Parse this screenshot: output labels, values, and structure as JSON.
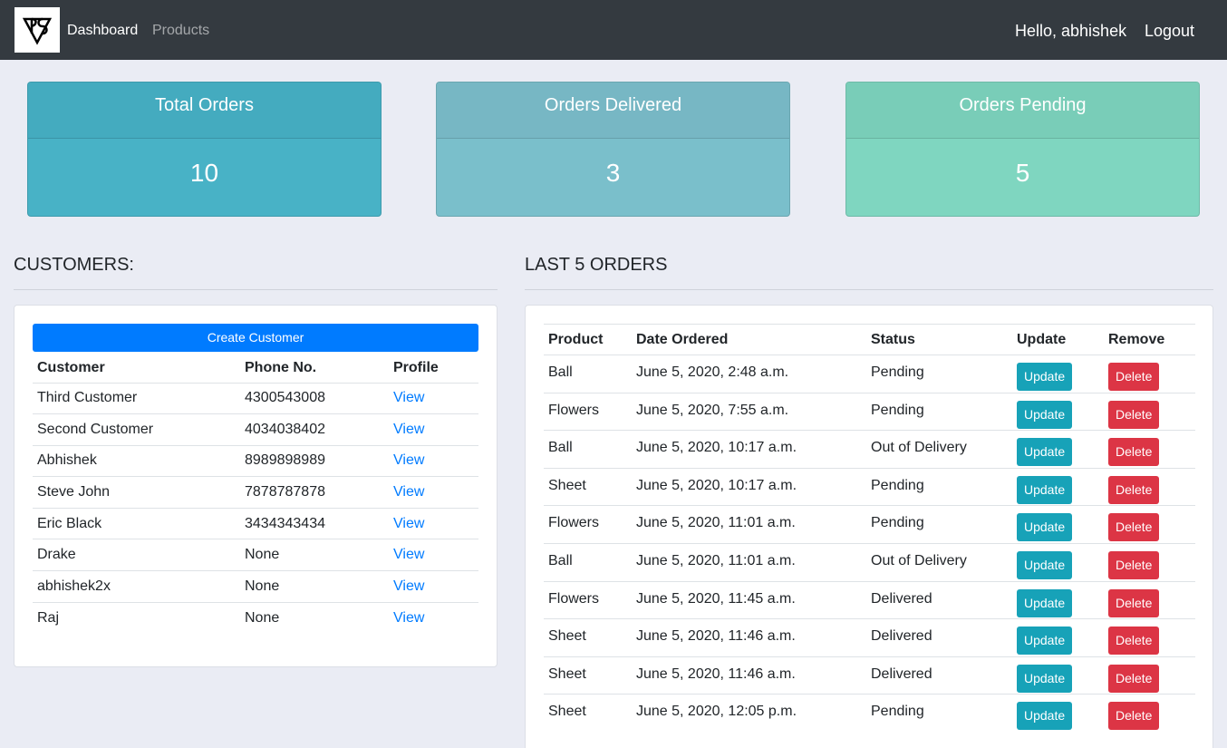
{
  "nav": {
    "dashboard": "Dashboard",
    "products": "Products",
    "greeting": "Hello, abhishek",
    "logout": "Logout"
  },
  "stats": {
    "total": {
      "label": "Total Orders",
      "value": "10"
    },
    "delivered": {
      "label": "Orders Delivered",
      "value": "3"
    },
    "pending": {
      "label": "Orders Pending",
      "value": "5"
    }
  },
  "customers": {
    "title": "CUSTOMERS:",
    "create_label": "Create Customer",
    "headers": [
      "Customer",
      "Phone No.",
      "Profile"
    ],
    "rows": [
      {
        "name": "Third Customer",
        "phone": "4300543008",
        "link": "View"
      },
      {
        "name": "Second Customer",
        "phone": "4034038402",
        "link": "View"
      },
      {
        "name": "Abhishek",
        "phone": "8989898989",
        "link": "View"
      },
      {
        "name": "Steve John",
        "phone": "7878787878",
        "link": "View"
      },
      {
        "name": "Eric Black",
        "phone": "3434343434",
        "link": "View"
      },
      {
        "name": "Drake",
        "phone": "None",
        "link": "View"
      },
      {
        "name": "abhishek2x",
        "phone": "None",
        "link": "View"
      },
      {
        "name": "Raj",
        "phone": "None",
        "link": "View"
      }
    ]
  },
  "orders": {
    "title": "LAST 5 ORDERS",
    "headers": [
      "Product",
      "Date Ordered",
      "Status",
      "Update",
      "Remove"
    ],
    "update_label": "Update",
    "delete_label": "Delete",
    "rows": [
      {
        "product": "Ball",
        "date": "June 5, 2020, 2:48 a.m.",
        "status": "Pending"
      },
      {
        "product": "Flowers",
        "date": "June 5, 2020, 7:55 a.m.",
        "status": "Pending"
      },
      {
        "product": "Ball",
        "date": "June 5, 2020, 10:17 a.m.",
        "status": "Out of Delivery"
      },
      {
        "product": "Sheet",
        "date": "June 5, 2020, 10:17 a.m.",
        "status": "Pending"
      },
      {
        "product": "Flowers",
        "date": "June 5, 2020, 11:01 a.m.",
        "status": "Pending"
      },
      {
        "product": "Ball",
        "date": "June 5, 2020, 11:01 a.m.",
        "status": "Out of Delivery"
      },
      {
        "product": "Flowers",
        "date": "June 5, 2020, 11:45 a.m.",
        "status": "Delivered"
      },
      {
        "product": "Sheet",
        "date": "June 5, 2020, 11:46 a.m.",
        "status": "Delivered"
      },
      {
        "product": "Sheet",
        "date": "June 5, 2020, 11:46 a.m.",
        "status": "Delivered"
      },
      {
        "product": "Sheet",
        "date": "June 5, 2020, 12:05 p.m.",
        "status": "Pending"
      }
    ]
  }
}
